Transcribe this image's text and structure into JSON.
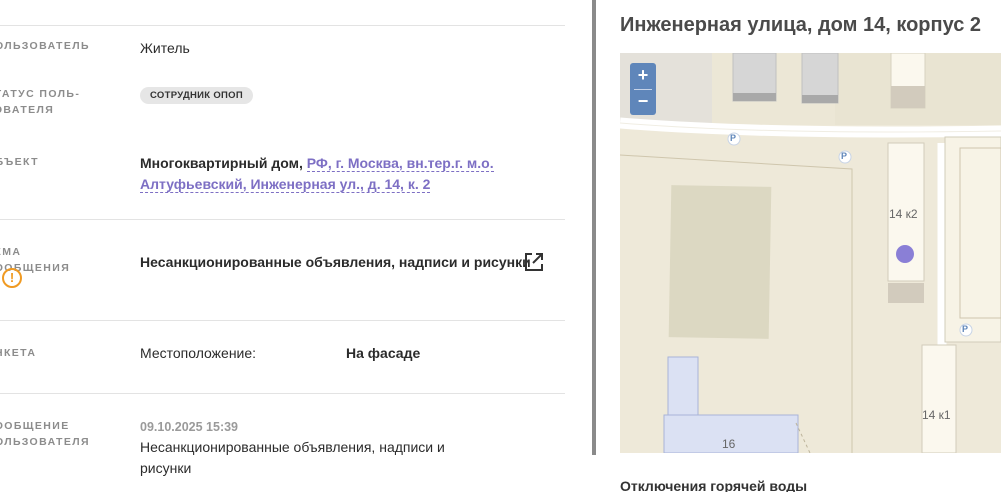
{
  "details": {
    "user_label": "Пользователь",
    "user_value": "Житель",
    "status_label_1": "Статус поль-",
    "status_label_2": "зователя",
    "status_badge": "СОТРУДНИК ОПОП",
    "object_label": "Объект",
    "object_type": "Многоквартирный дом,",
    "object_address_1": "РФ, г. Москва, вн.тер.г. м.о.",
    "object_address_2": "Алтуфьевский, Инженерная ул., д. 14, к. 2",
    "topic_label": "Тема сообщения",
    "topic_value": "Несанкционированные объявления, надписи и рисунки",
    "form_label": "Анкета",
    "form_field": "Местоположение:",
    "form_field_value": "На фасаде",
    "message_label_1": "Сообщение",
    "message_label_2": "пользователя",
    "message_date": "09.10.2025 15:39",
    "message_text_1": "Несанкционированные объявления, надписи и",
    "message_text_2": "рисунки"
  },
  "map_panel": {
    "address_title": "Инженерная улица, дом 14, корпус 2",
    "zoom_in": "+",
    "zoom_out": "−",
    "building_label_main": "14 к2",
    "building_label_2": "14 к1",
    "building_label_3": "16",
    "parking_label": "P",
    "marker_color": "#8a7fd6"
  },
  "outage_title": "Отключения горячей воды",
  "colors": {
    "link": "#7d6fc4",
    "warning": "#f09a22",
    "zoom_control": "#5f86ba"
  }
}
